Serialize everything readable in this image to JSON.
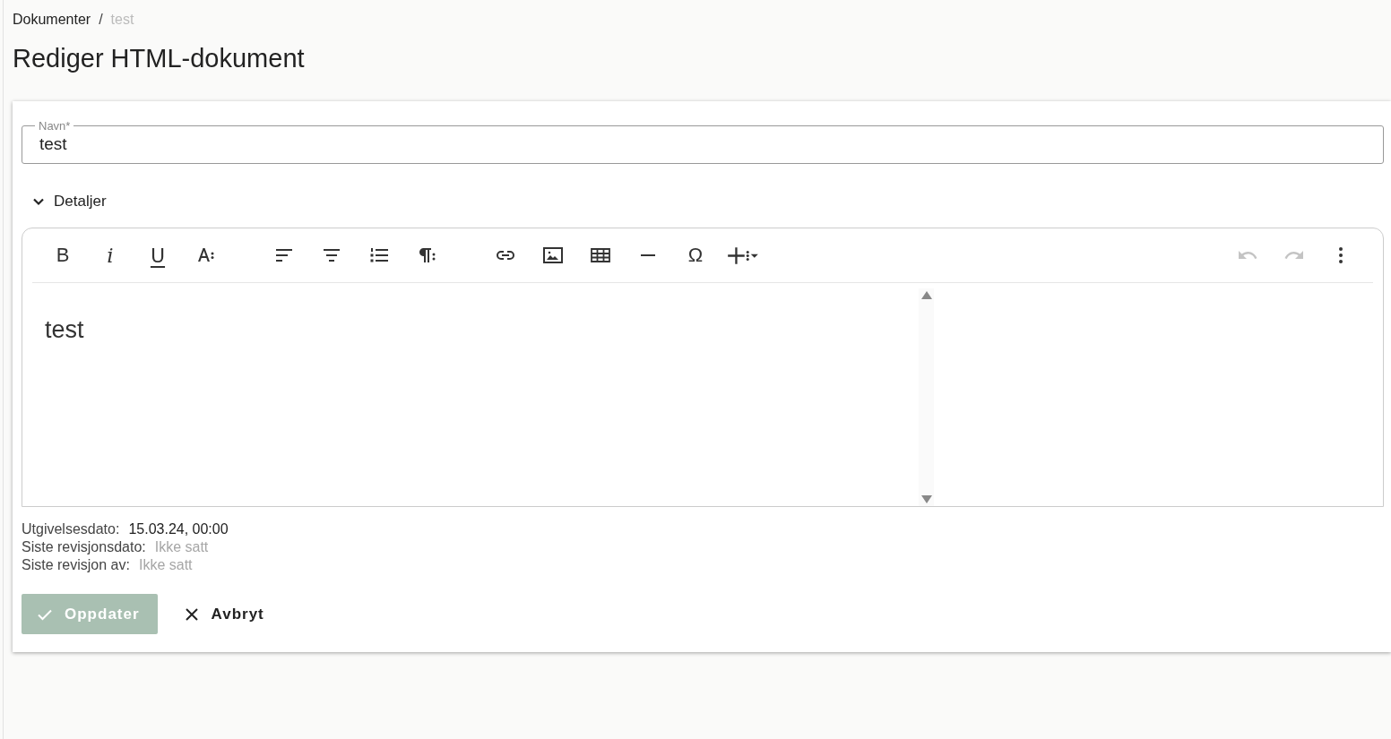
{
  "breadcrumb": [
    {
      "label": "Dokumenter",
      "current": false
    },
    {
      "label": "test",
      "current": true
    }
  ],
  "breadcrumb_separator": "/",
  "title": "Rediger HTML-dokument",
  "name_field": {
    "label": "Navn*",
    "value": "test"
  },
  "details": {
    "label": "Detaljer",
    "expanded": true
  },
  "toolbar": {
    "groups": [
      [
        {
          "kind": "text",
          "label": "B"
        },
        {
          "kind": "text",
          "label": "i"
        },
        {
          "kind": "text",
          "label": "U"
        },
        {
          "kind": "icon"
        }
      ],
      [
        {
          "kind": "icon"
        },
        {
          "kind": "icon"
        },
        {
          "kind": "icon"
        },
        {
          "kind": "icon"
        }
      ],
      [
        {
          "kind": "icon"
        },
        {
          "kind": "icon"
        },
        {
          "kind": "icon"
        },
        {
          "kind": "icon"
        },
        {
          "kind": "text",
          "label": "Ω"
        },
        {
          "kind": "icon"
        }
      ]
    ],
    "right": [
      {
        "disabled": true
      },
      {
        "disabled": true
      },
      {
        "disabled": false
      }
    ]
  },
  "editor_content": "test",
  "meta": [
    {
      "label": "Utgivelsesdato:",
      "value": "15.03.24, 00:00",
      "set": true
    },
    {
      "label": "Siste revisjonsdato:",
      "value": "Ikke satt",
      "set": false
    },
    {
      "label": "Siste revisjon av:",
      "value": "Ikke satt",
      "set": false
    }
  ],
  "buttons": [
    {
      "kind": "primary",
      "label": "Oppdater",
      "disabled": true
    },
    {
      "kind": "cancel",
      "label": "Avbryt"
    }
  ]
}
